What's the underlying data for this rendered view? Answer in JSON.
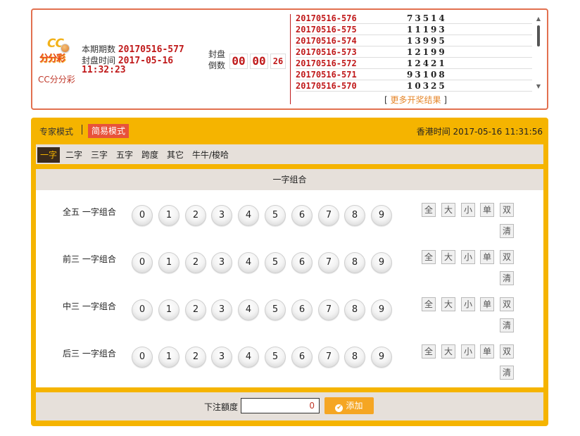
{
  "lottery": {
    "logo_text_cc": "CC",
    "logo_text_fff": "分分彩",
    "name": "CC分分彩",
    "current_period_label": "本期期数",
    "current_period": "20170516-577",
    "close_time_label": "封盘时间",
    "close_date": "2017-05-16",
    "close_time": "11:32:23",
    "countdown_label": "封盘倒数",
    "countdown": {
      "hours": "00",
      "minutes": "00",
      "seconds": "26"
    }
  },
  "results": [
    {
      "period": "20170516-576",
      "numbers": "73514"
    },
    {
      "period": "20170516-575",
      "numbers": "11193"
    },
    {
      "period": "20170516-574",
      "numbers": "13995"
    },
    {
      "period": "20170516-573",
      "numbers": "12199"
    },
    {
      "period": "20170516-572",
      "numbers": "12421"
    },
    {
      "period": "20170516-571",
      "numbers": "93108"
    },
    {
      "period": "20170516-570",
      "numbers": "10325"
    }
  ],
  "more_results": {
    "open": "[",
    "label": "更多开奖结果",
    "close": "]"
  },
  "scroll": {
    "up": "▲",
    "down": "▼"
  },
  "modes": {
    "expert": "专家模式",
    "simple": "简易模式"
  },
  "hk_time": "香港时间 2017-05-16 11:31:56",
  "tabs": [
    "一字",
    "二字",
    "三字",
    "五字",
    "跨度",
    "其它",
    "牛牛/梭哈"
  ],
  "active_tab": "一字",
  "section_title": "一字组合",
  "rows": [
    {
      "label": "全五 一字组合"
    },
    {
      "label": "前三 一字组合"
    },
    {
      "label": "中三 一字组合"
    },
    {
      "label": "后三 一字组合"
    }
  ],
  "digits": [
    "0",
    "1",
    "2",
    "3",
    "4",
    "5",
    "6",
    "7",
    "8",
    "9"
  ],
  "quick_buttons": [
    "全",
    "大",
    "小",
    "单",
    "双",
    "清"
  ],
  "bet": {
    "label": "下注額度",
    "value": "0",
    "add_label": "添加",
    "add_icon": "✔"
  },
  "colors": {
    "accent": "#f5b400",
    "period_red": "#c0191a",
    "active_mode": "#e8523a",
    "add_button": "#f5a623"
  }
}
